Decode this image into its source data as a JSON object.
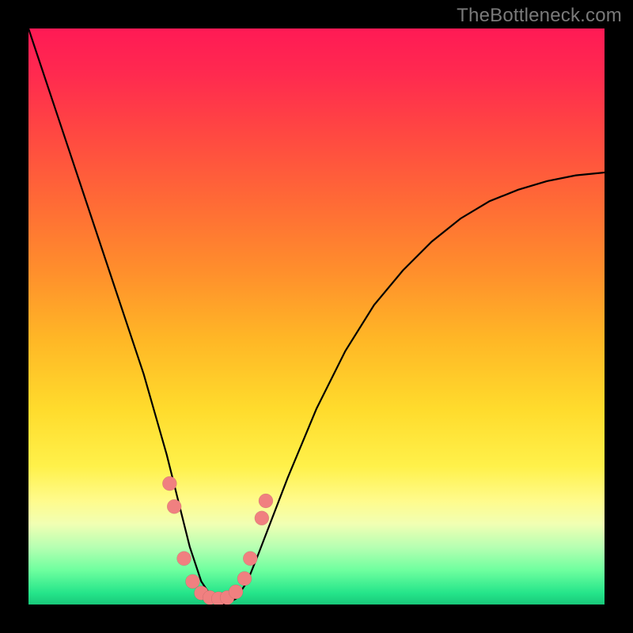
{
  "watermark": "TheBottleneck.com",
  "colors": {
    "frame": "#000000",
    "gradient_top": "#ff1a55",
    "gradient_mid": "#ffdb2c",
    "gradient_bottom": "#19c87a",
    "bead": "#f08080",
    "curve": "#000000"
  },
  "chart_data": {
    "type": "line",
    "title": "",
    "xlabel": "",
    "ylabel": "",
    "xlim": [
      0,
      100
    ],
    "ylim": [
      0,
      100
    ],
    "grid": false,
    "legend": false,
    "series": [
      {
        "name": "bottleneck-curve",
        "x": [
          0,
          5,
          10,
          15,
          20,
          22,
          24,
          26,
          28,
          30,
          32,
          33,
          34,
          36,
          38,
          40,
          45,
          50,
          55,
          60,
          65,
          70,
          75,
          80,
          85,
          90,
          95,
          100
        ],
        "y": [
          100,
          85,
          70,
          55,
          40,
          33,
          26,
          18,
          10,
          4,
          1,
          0,
          0,
          1,
          4,
          9,
          22,
          34,
          44,
          52,
          58,
          63,
          67,
          70,
          72,
          73.5,
          74.5,
          75
        ]
      }
    ],
    "markers": [
      {
        "x": 24.5,
        "y": 21
      },
      {
        "x": 25.3,
        "y": 17
      },
      {
        "x": 27.0,
        "y": 8
      },
      {
        "x": 28.5,
        "y": 4
      },
      {
        "x": 30.0,
        "y": 2
      },
      {
        "x": 31.5,
        "y": 1.2
      },
      {
        "x": 33.0,
        "y": 1
      },
      {
        "x": 34.5,
        "y": 1.2
      },
      {
        "x": 36.0,
        "y": 2.2
      },
      {
        "x": 37.5,
        "y": 4.5
      },
      {
        "x": 38.5,
        "y": 8
      },
      {
        "x": 40.5,
        "y": 15
      },
      {
        "x": 41.2,
        "y": 18
      }
    ]
  }
}
